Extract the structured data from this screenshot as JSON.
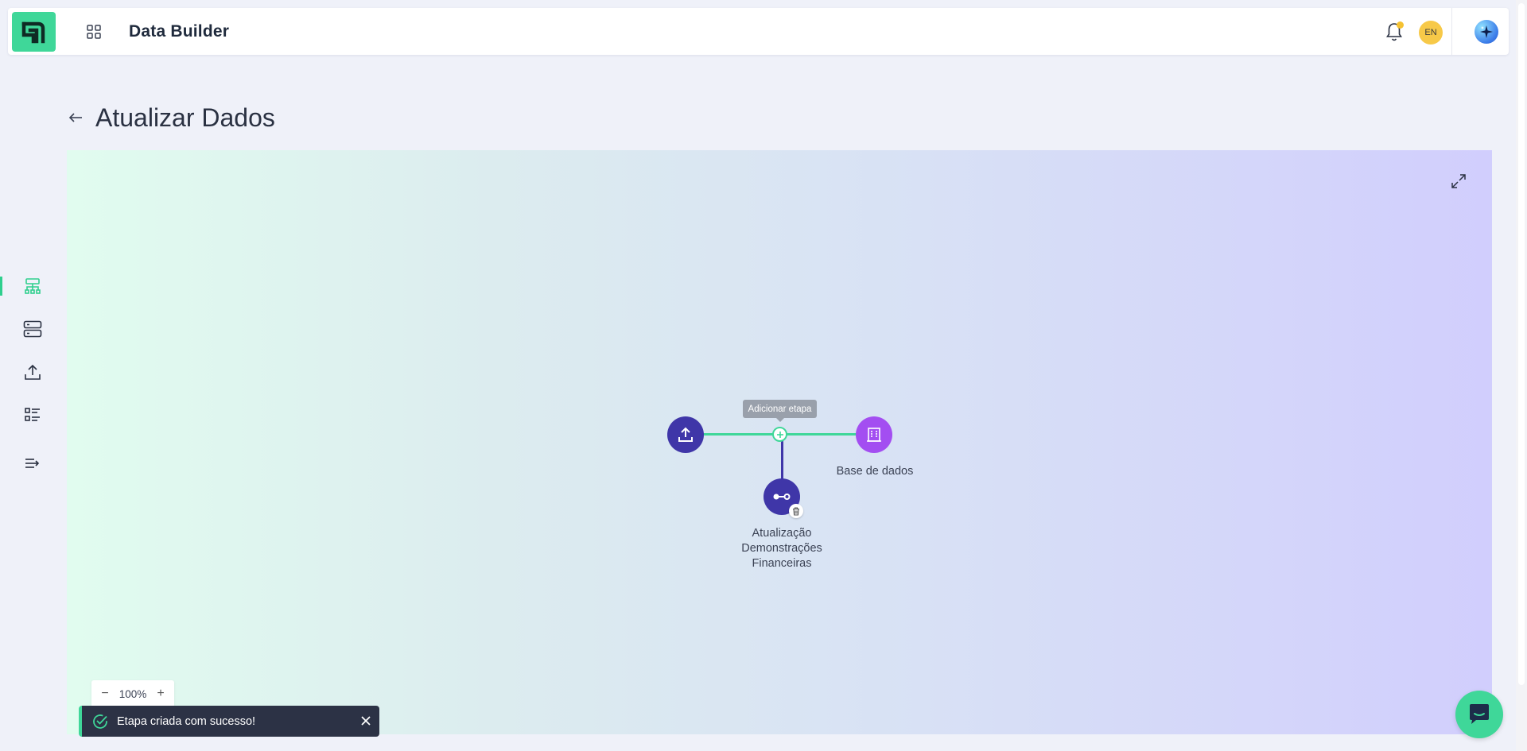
{
  "header": {
    "app_title": "Data Builder",
    "language": "EN",
    "icons": {
      "logo": "brand-logo-icon",
      "apps": "grid-icon",
      "notifications": "bell-icon",
      "ai": "sparkles-icon"
    }
  },
  "sidenav": {
    "items": [
      {
        "name": "workflows",
        "icon": "sitemap-icon",
        "active": true
      },
      {
        "name": "databases",
        "icon": "server-icon",
        "active": false
      },
      {
        "name": "uploads",
        "icon": "upload-icon",
        "active": false
      },
      {
        "name": "tasks",
        "icon": "checklist-icon",
        "active": false
      },
      {
        "name": "expand",
        "icon": "expand-menu-icon",
        "active": false
      }
    ]
  },
  "page": {
    "title": "Atualizar Dados"
  },
  "flow": {
    "tooltip": "Adicionar etapa",
    "nodes": {
      "source": {
        "icon": "upload-icon",
        "label": ""
      },
      "destination": {
        "icon": "building-icon",
        "label": "Base de dados"
      },
      "transform": {
        "icon": "transform-icon",
        "label_lines": [
          "Atualização",
          "Demonstrações",
          "Financeiras"
        ]
      }
    }
  },
  "zoom": {
    "level": "100%",
    "minus": "−",
    "plus": "+"
  },
  "toast": {
    "message": "Etapa criada com sucesso!",
    "type": "success"
  },
  "colors": {
    "accent_green": "#3fd799",
    "indigo": "#3f36a8",
    "purple": "#a34ef1",
    "toast_bg": "#2c3245"
  }
}
